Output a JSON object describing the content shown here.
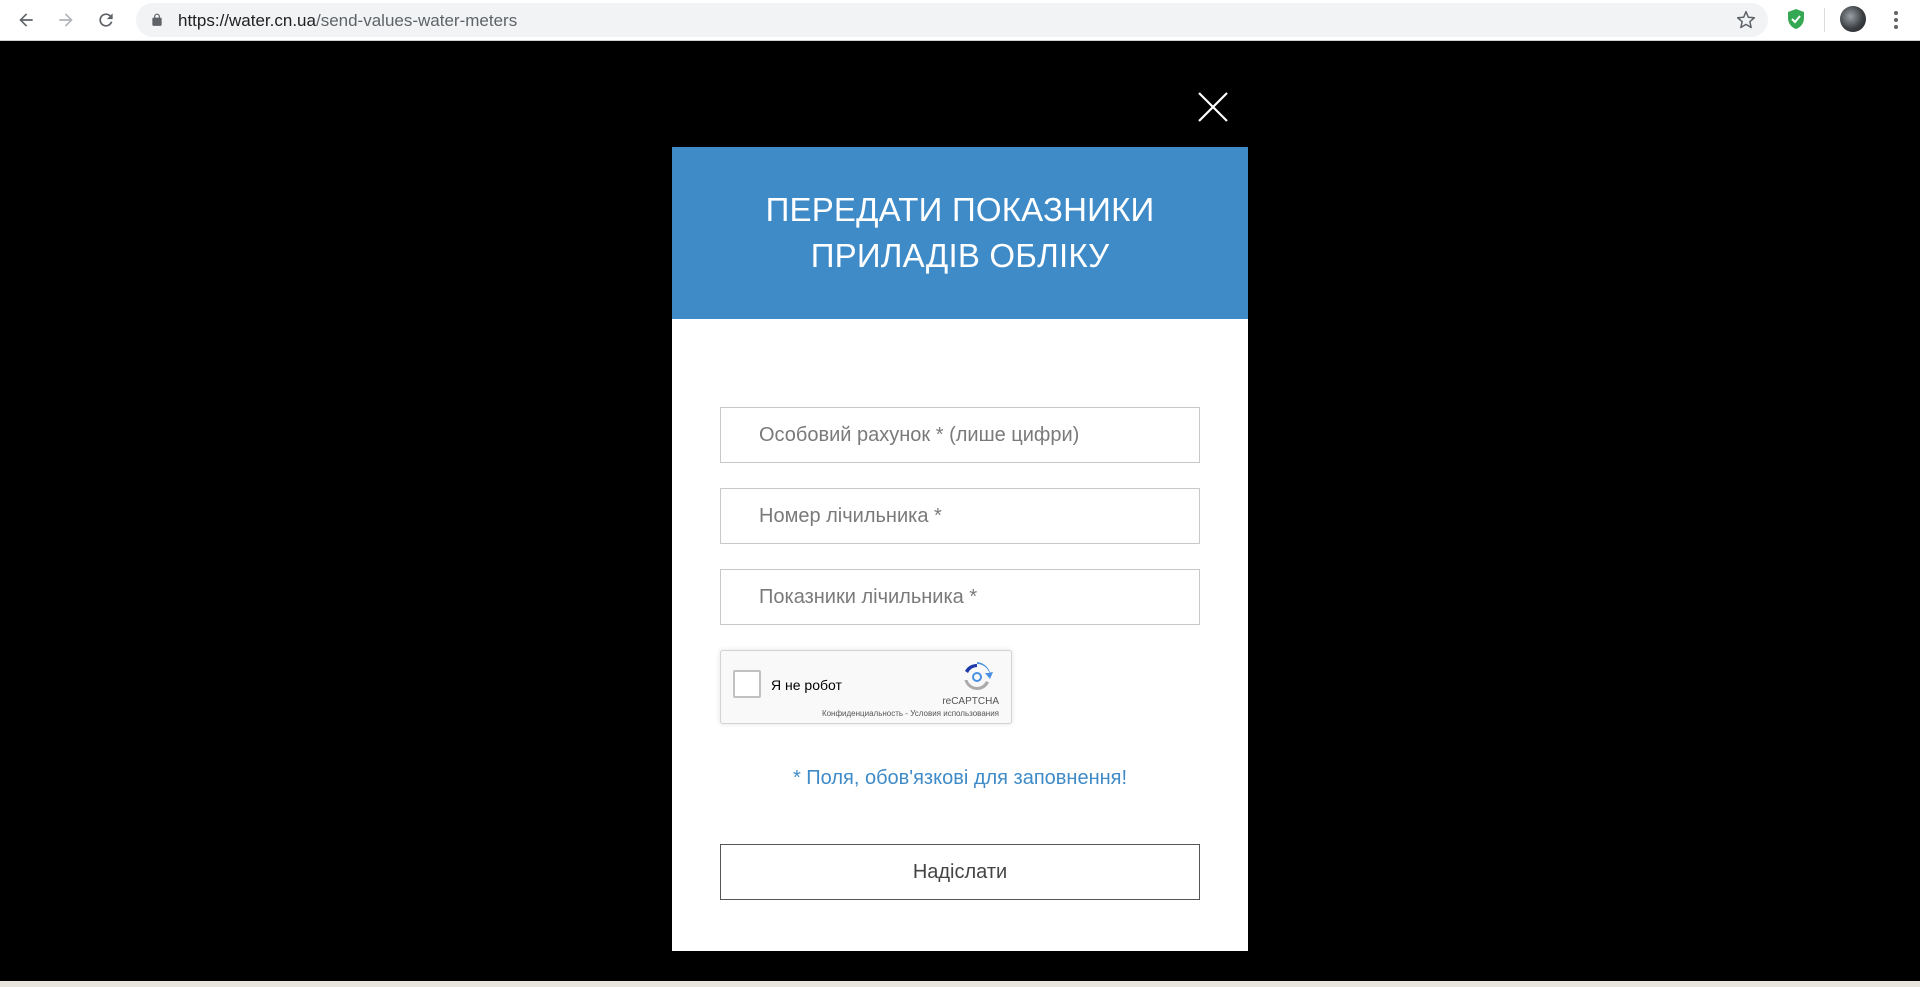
{
  "browser": {
    "url_host": "https://water.cn.ua",
    "url_path": "/send-values-water-meters",
    "icons": {
      "back": "arrow-left-icon",
      "forward": "arrow-right-icon",
      "reload": "reload-icon",
      "lock": "lock-icon",
      "bookmark": "star-icon",
      "extension": "shield-check-icon",
      "menu": "kebab-menu-icon"
    }
  },
  "modal": {
    "title": "ПЕРЕДАТИ ПОКАЗНИКИ ПРИЛАДІВ ОБЛІКУ",
    "fields": {
      "account_placeholder": "Особовий рахунок * (лише цифри)",
      "meter_number_placeholder": "Номер лічильника *",
      "meter_reading_placeholder": "Показники лічильника *"
    },
    "recaptcha": {
      "label": "Я не робот",
      "brand": "reCAPTCHA",
      "links": "Конфиденциальность - Условия использования"
    },
    "required_note": "* Поля, обов'язкові для заповнення!",
    "submit_label": "Надіслати"
  },
  "colors": {
    "header_blue": "#3f8bc8",
    "overlay": "#000000",
    "accent_text": "#3f8bc8"
  }
}
